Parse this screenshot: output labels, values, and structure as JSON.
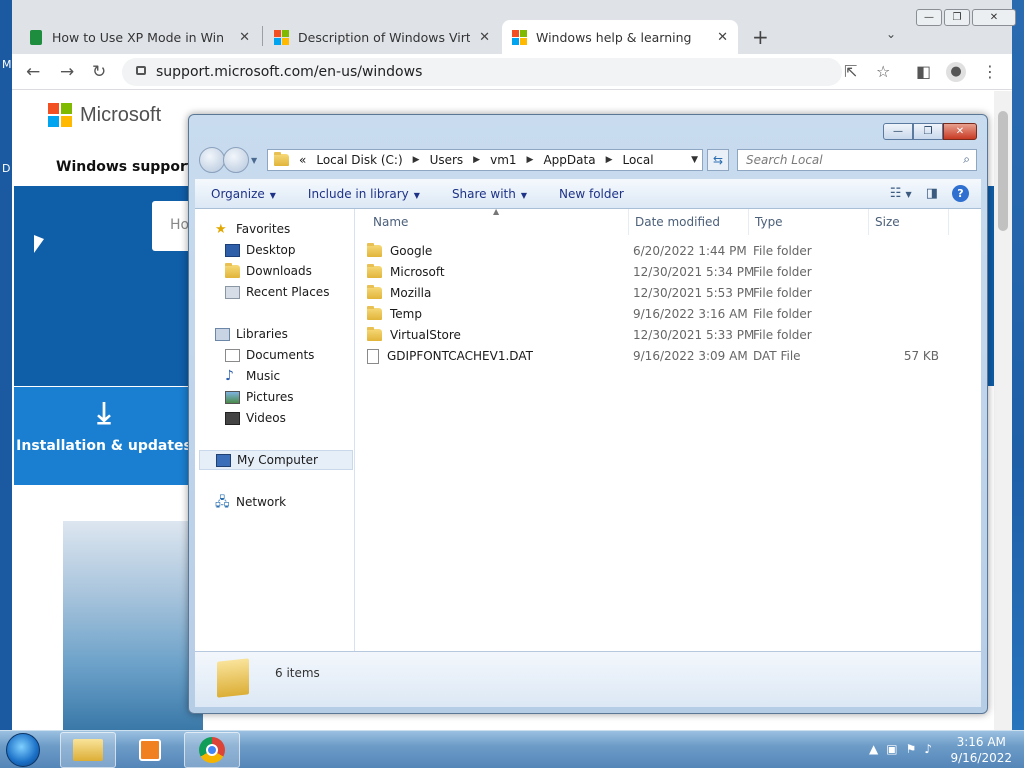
{
  "desktop": {
    "left_labels": [
      "M",
      "D"
    ]
  },
  "browser": {
    "tabs": [
      {
        "label": "How to Use XP Mode in Windows"
      },
      {
        "label": "Description of Windows Virtual PC"
      },
      {
        "label": "Windows help & learning"
      }
    ],
    "new_tab_icon": "plus-icon",
    "address": "support.microsoft.com/en-us/windows",
    "page": {
      "brand": "Microsoft",
      "section": "Windows support",
      "search_placeholder": "Ho",
      "install_label": "Installation & updates"
    }
  },
  "explorer": {
    "breadcrumb": [
      "«",
      "Local Disk (C:)",
      "Users",
      "vm1",
      "AppData",
      "Local"
    ],
    "search_placeholder": "Search Local",
    "commands": [
      "Organize",
      "Include in library",
      "Share with",
      "New folder"
    ],
    "nav": {
      "favorites": "Favorites",
      "favorites_items": [
        "Desktop",
        "Downloads",
        "Recent Places"
      ],
      "libraries": "Libraries",
      "libraries_items": [
        "Documents",
        "Music",
        "Pictures",
        "Videos"
      ],
      "computer": "My Computer",
      "network": "Network"
    },
    "columns": [
      "Name",
      "Date modified",
      "Type",
      "Size"
    ],
    "files": [
      {
        "name": "Google",
        "date": "6/20/2022 1:44 PM",
        "type": "File folder",
        "size": "",
        "kind": "folder"
      },
      {
        "name": "Microsoft",
        "date": "12/30/2021 5:34 PM",
        "type": "File folder",
        "size": "",
        "kind": "folder"
      },
      {
        "name": "Mozilla",
        "date": "12/30/2021 5:53 PM",
        "type": "File folder",
        "size": "",
        "kind": "folder"
      },
      {
        "name": "Temp",
        "date": "9/16/2022 3:16 AM",
        "type": "File folder",
        "size": "",
        "kind": "folder"
      },
      {
        "name": "VirtualStore",
        "date": "12/30/2021 5:33 PM",
        "type": "File folder",
        "size": "",
        "kind": "folder"
      },
      {
        "name": "GDIPFONTCACHEV1.DAT",
        "date": "9/16/2022 3:09 AM",
        "type": "DAT File",
        "size": "57 KB",
        "kind": "file"
      }
    ],
    "status": "6 items"
  },
  "taskbar": {
    "time": "3:16 AM",
    "date": "9/16/2022"
  }
}
